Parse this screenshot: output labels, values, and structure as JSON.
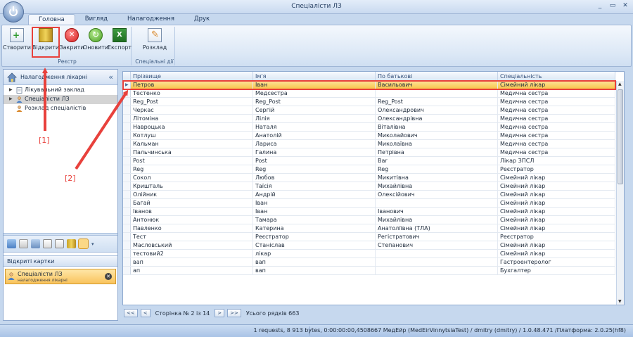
{
  "window": {
    "title": "Спеціалісти ЛЗ",
    "controls": [
      "_",
      "▭",
      "✕"
    ]
  },
  "ribbon": {
    "tabs": [
      {
        "label": "Головна",
        "active": true
      },
      {
        "label": "Вигляд",
        "active": false
      },
      {
        "label": "Налагодження",
        "active": false
      },
      {
        "label": "Друк",
        "active": false
      }
    ],
    "groups": [
      {
        "label": "Реєстр",
        "buttons": [
          {
            "label": "Створити",
            "icon": "create-icon"
          },
          {
            "label": "Відкрити",
            "icon": "open-icon"
          },
          {
            "label": "Закрити",
            "icon": "close-icon"
          },
          {
            "label": "Оновити",
            "icon": "refresh-icon"
          },
          {
            "label": "Експорт",
            "icon": "excel-export-icon"
          }
        ]
      },
      {
        "label": "Спеціальні дії",
        "buttons": [
          {
            "label": "Розклад",
            "icon": "schedule-icon"
          }
        ]
      }
    ]
  },
  "left_panel": {
    "title": "Налагодження лікарні",
    "collapse": "«",
    "tree": [
      {
        "label": "Лікувальний заклад",
        "expandable": true,
        "selected": false
      },
      {
        "label": "Спеціалісти ЛЗ",
        "expandable": true,
        "selected": true
      },
      {
        "label": "Розклад спеціалістів",
        "expandable": false,
        "selected": false
      }
    ],
    "open_cards_title": "Відкриті картки",
    "open_card": {
      "title": "Спеціалісти ЛЗ",
      "subtitle": "налагодження лікарні"
    }
  },
  "grid": {
    "columns": [
      "Прізвище",
      "Ім'я",
      "По батькові",
      "Спеціальність"
    ],
    "rows": [
      [
        "Петров",
        "Іван",
        "Васильович",
        "Сімейний лікар"
      ],
      [
        "Тестенко",
        "Медсестра",
        "",
        "Медична сестра"
      ],
      [
        "Reg_Post",
        "Reg_Post",
        "Reg_Post",
        "Медична сестра"
      ],
      [
        "Черкас",
        "Сергій",
        "Олександрович",
        "Медична сестра"
      ],
      [
        "Літоміна",
        "Лілія",
        "Олександрівна",
        "Медична сестра"
      ],
      [
        "Навроцька",
        "Наталя",
        "Віталівна",
        "Медична сестра"
      ],
      [
        "Котлуш",
        "Анатолій",
        "Миколайович",
        "Медична сестра"
      ],
      [
        "Кальман",
        "Лариса",
        "Миколаївна",
        "Медична сестра"
      ],
      [
        "Пальчинська",
        "Галина",
        "Петрівна",
        "Медична сестра"
      ],
      [
        "Post",
        "Post",
        "Bar",
        "Лікар ЗПСЛ"
      ],
      [
        "Reg",
        "Reg",
        "Reg",
        "Реєстратор"
      ],
      [
        "Сокол",
        "Любов",
        "Микитівна",
        "Сімейний лікар"
      ],
      [
        "Кришталь",
        "Таїсія",
        "Михайлівна",
        "Сімейний лікар"
      ],
      [
        "Олійник",
        "Андрій",
        "Олексійович",
        "Сімейний лікар"
      ],
      [
        "Багай",
        "Іван",
        "",
        "Сімейний лікар"
      ],
      [
        "Іванов",
        "Іван",
        "Іванович",
        "Сімейний лікар"
      ],
      [
        "Антонюк",
        "Тамара",
        "Михайлівна",
        "Сімейний лікар"
      ],
      [
        "Павленко",
        "Катерина",
        "Анатоліївна (ТЛА)",
        "Сімейний лікар"
      ],
      [
        "Тест",
        "Реєстратор",
        "Регістратович",
        "Реєстратор"
      ],
      [
        "Масловський",
        "Станіслав",
        "Степанович",
        "Сімейний лікар"
      ],
      [
        "тестовий2",
        "лікар",
        "",
        "Сімейний лікар"
      ],
      [
        "вап",
        "вап",
        "",
        "Гастроентеролог"
      ],
      [
        "ап",
        "вап",
        "",
        "Бухгалтер"
      ]
    ],
    "selected_row": 0
  },
  "pager": {
    "first": "<<",
    "prev": "<",
    "page_text": "Сторінка № 2 із 14",
    "next": ">",
    "last": ">>",
    "total_text": "Усього рядків 663"
  },
  "status": {
    "text": "1 requests, 8 913 bytes, 0:00:00:00,4508667  МедЕйр (MedEirVinnytsiaTest) / dmitry (dmitry) / 1.0.48.471 /Платформа: 2.0.25(hf8)"
  },
  "annotations": [
    {
      "label": "[1]"
    },
    {
      "label": "[2]"
    }
  ],
  "colors": {
    "annotation": "#e8413c",
    "selection": "#f8c54c",
    "ribbon_border": "#9fb6d6"
  }
}
